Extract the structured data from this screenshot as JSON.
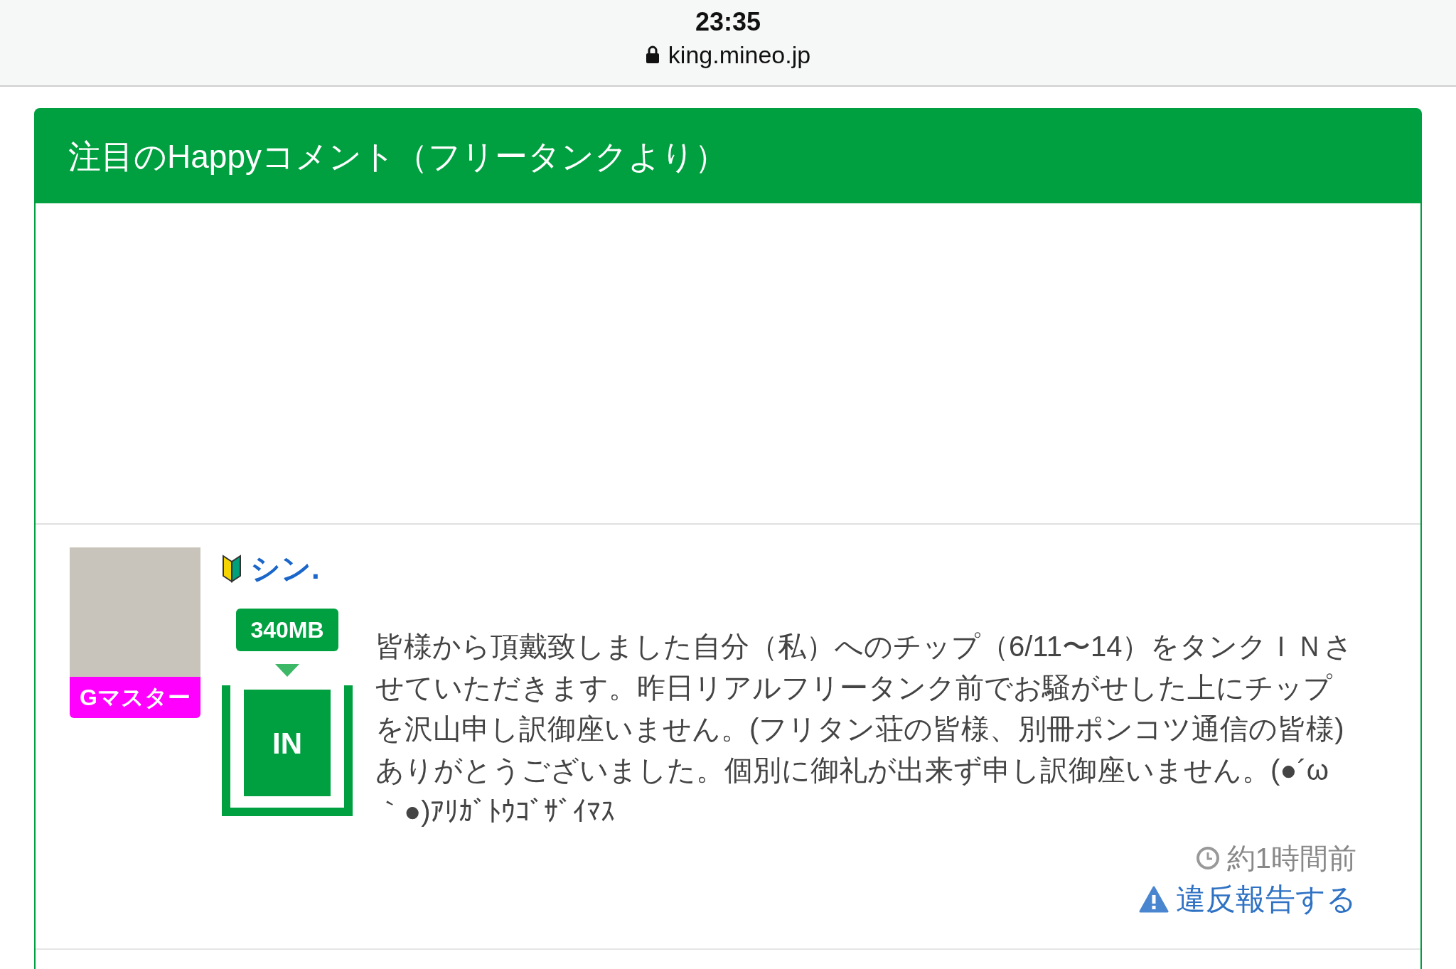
{
  "status_bar": {
    "time": "23:35",
    "url": "king.mineo.jp",
    "secure": true
  },
  "panel": {
    "title": "注目のHappyコメント（フリータンクより）"
  },
  "comments": [
    {
      "rank": "Gマスター",
      "beginner": true,
      "user": "シン.",
      "amount": "340MB",
      "direction": "IN",
      "text": "皆様から頂戴致しました自分（私）へのチップ（6/11〜14）をタンクＩＮさせていただきます。昨日リアルフリータンク前でお騒がせした上にチップを沢山申し訳御座いません。(フリタン荘の皆様、別冊ポンコツ通信の皆様)ありがとうございました。個別に御礼が出来ず申し訳御座いません。(●´ω｀●)ｱﾘｶﾞﾄｳｺﾞｻﾞｲﾏｽ",
      "time": "約1時間前",
      "report": "違反報告する"
    }
  ]
}
